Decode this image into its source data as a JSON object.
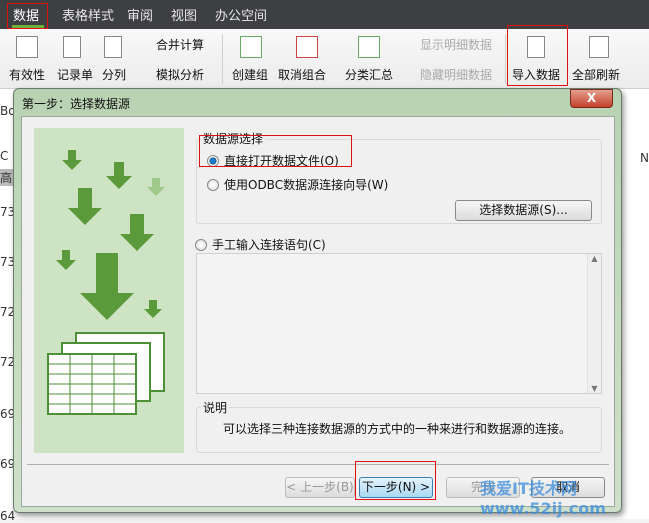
{
  "tabs": [
    "数据",
    "表格样式",
    "审阅",
    "视图",
    "办公空间"
  ],
  "ribbon": {
    "validity": "有效性",
    "record_form": "记录单",
    "split_column": "分列",
    "consolidate": "合并计算",
    "what_if": "模拟分析",
    "group": "创建组",
    "ungroup": "取消组合",
    "subtotal": "分类汇总",
    "show_detail": "显示明细数据",
    "hide_detail": "隐藏明细数据",
    "import_data": "导入数据",
    "refresh_all": "全部刷新"
  },
  "sheet": {
    "cell_ref": "Bo",
    "col_c": "C",
    "col_n": "N",
    "header_cell": "高",
    "row_values": [
      "73",
      "73",
      "72",
      "72",
      "69",
      "69",
      "64"
    ]
  },
  "dialog": {
    "title": "第一步：选择数据源",
    "close": "X",
    "source_group_label": "数据源选择",
    "option_open_file": "直接打开数据文件(O)",
    "option_odbc": "使用ODBC数据源连接向导(W)",
    "select_source_button": "选择数据源(S)...",
    "option_manual": "手工输入连接语句(C)",
    "desc_label": "说明",
    "desc_text": "可以选择三种连接数据源的方式中的一种来进行和数据源的连接。",
    "buttons": {
      "back": "< 上一步(B)",
      "next": "下一步(N) >",
      "finish": "完成",
      "cancel": "取消"
    }
  },
  "watermark": "我爱IT技术网 www.52ij.com",
  "colors": {
    "accent_green": "#6cb13c",
    "highlight_red": "#e01010",
    "illus_bg": "#cde3c3",
    "arrow_green": "#5a9a3a"
  }
}
